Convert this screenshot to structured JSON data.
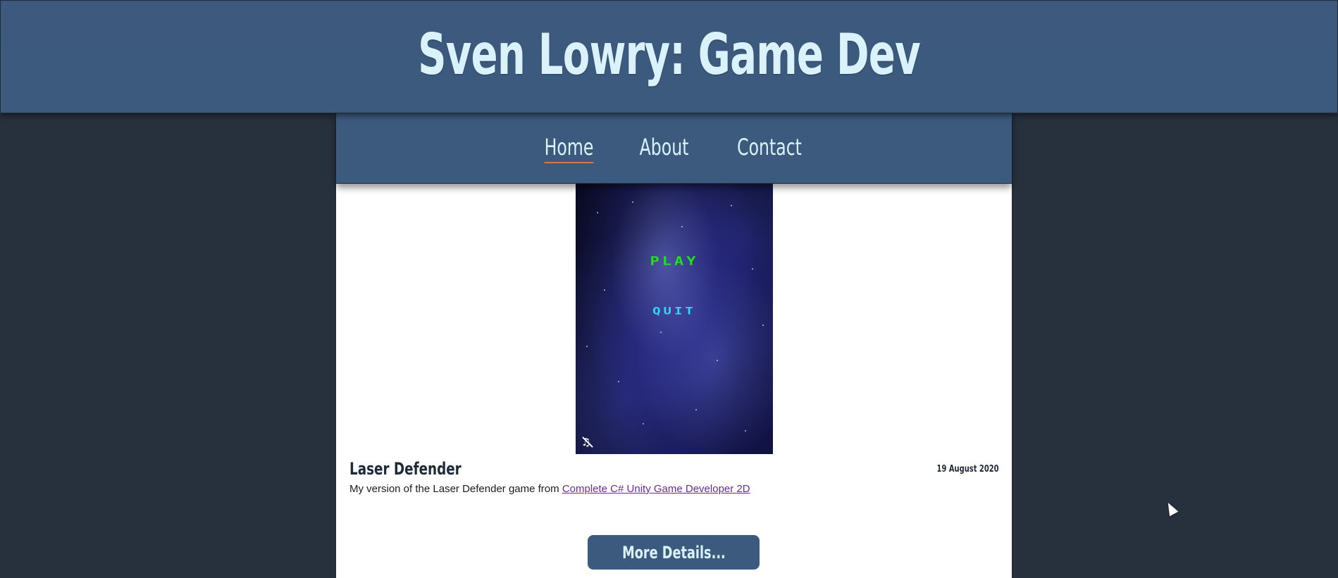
{
  "header": {
    "title": "Sven Lowry: Game Dev"
  },
  "nav": {
    "items": [
      {
        "label": "Home",
        "active": true
      },
      {
        "label": "About",
        "active": false
      },
      {
        "label": "Contact",
        "active": false
      }
    ]
  },
  "project": {
    "screenshot": {
      "play_label": "PLAY",
      "quit_label": "QUIT",
      "mute_icon": "music-muted-icon"
    },
    "title": "Laser Defender",
    "date": "19 August 2020",
    "description_prefix": "My version of the Laser Defender game from ",
    "course_link": "Complete C# Unity Game Developer 2D",
    "more_button": "More Details..."
  },
  "colors": {
    "page_background": "#27303d",
    "header_background": "#3c5a7d",
    "header_text": "#d9f2fb",
    "nav_active_underline": "#d9784a",
    "link": "#6a2a9b",
    "play_text": "#23e01d",
    "quit_text": "#2cd8f5"
  }
}
